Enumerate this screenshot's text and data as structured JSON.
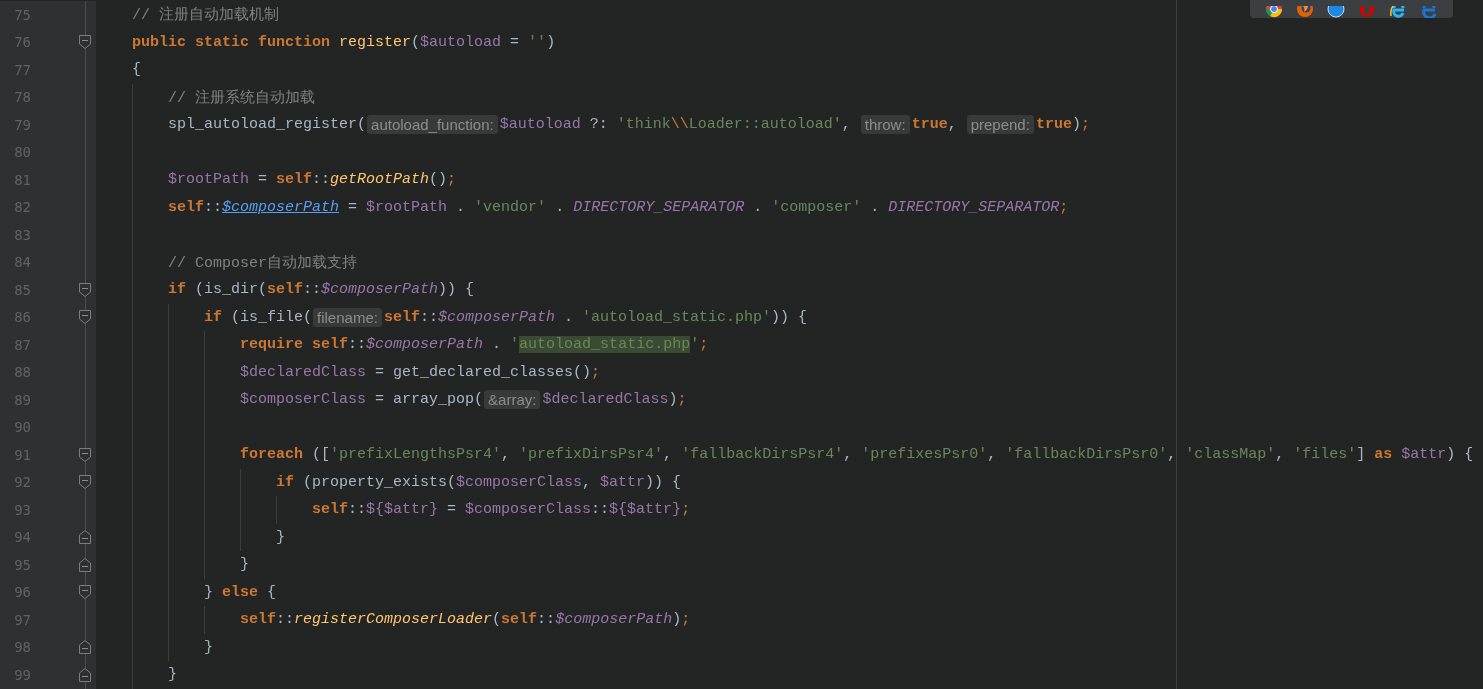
{
  "editor": {
    "lines": [
      {
        "number": "75",
        "tokens": [
          {
            "kind": "comment",
            "text": "    // 注册自动加载机制"
          }
        ]
      },
      {
        "number": "76",
        "fold_start": true,
        "tokens": [
          {
            "kind": "keyword",
            "text": "    public static function "
          },
          {
            "kind": "decl",
            "text": "register"
          },
          {
            "kind": "plain",
            "text": "("
          },
          {
            "kind": "var",
            "text": "$autoload"
          },
          {
            "kind": "plain",
            "text": " = "
          },
          {
            "kind": "string",
            "text": "''"
          },
          {
            "kind": "plain",
            "text": ")"
          }
        ]
      },
      {
        "number": "77",
        "tokens": [
          {
            "kind": "plain",
            "text": "    {"
          }
        ]
      },
      {
        "number": "78",
        "tokens": [
          {
            "kind": "comment",
            "text": "        // 注册系统自动加载"
          }
        ]
      },
      {
        "number": "79",
        "tokens": [
          {
            "kind": "plain",
            "text": "        spl_autoload_register("
          },
          {
            "kind": "hint",
            "text": "autoload_function:"
          },
          {
            "kind": "var",
            "text": "$autoload"
          },
          {
            "kind": "plain",
            "text": " ?: "
          },
          {
            "kind": "string",
            "text": "'think"
          },
          {
            "kind": "escape",
            "text": "\\\\"
          },
          {
            "kind": "string",
            "text": "Loader::autoload'"
          },
          {
            "kind": "plain",
            "text": ", "
          },
          {
            "kind": "hint",
            "text": "throw:"
          },
          {
            "kind": "keyword",
            "text": "true"
          },
          {
            "kind": "plain",
            "text": ", "
          },
          {
            "kind": "hint",
            "text": "prepend:"
          },
          {
            "kind": "keyword",
            "text": "true"
          },
          {
            "kind": "plain",
            "text": ")"
          },
          {
            "kind": "semi",
            "text": ";"
          }
        ]
      },
      {
        "number": "80"
      },
      {
        "number": "81",
        "tokens": [
          {
            "kind": "var",
            "text": "        $rootPath"
          },
          {
            "kind": "plain",
            "text": " = "
          },
          {
            "kind": "keyword",
            "text": "self"
          },
          {
            "kind": "plain",
            "text": "::"
          },
          {
            "kind": "call",
            "text": "getRootPath"
          },
          {
            "kind": "plain",
            "text": "()"
          },
          {
            "kind": "semi",
            "text": ";"
          }
        ]
      },
      {
        "number": "82",
        "tokens": [
          {
            "kind": "keyword",
            "text": "        self"
          },
          {
            "kind": "plain",
            "text": "::"
          },
          {
            "kind": "link",
            "text": "$composerPath"
          },
          {
            "kind": "plain",
            "text": " = "
          },
          {
            "kind": "var",
            "text": "$rootPath"
          },
          {
            "kind": "plain",
            "text": " . "
          },
          {
            "kind": "string",
            "text": "'vendor'"
          },
          {
            "kind": "plain",
            "text": " . "
          },
          {
            "kind": "const",
            "text": "DIRECTORY_SEPARATOR"
          },
          {
            "kind": "plain",
            "text": " . "
          },
          {
            "kind": "string",
            "text": "'composer'"
          },
          {
            "kind": "plain",
            "text": " . "
          },
          {
            "kind": "const",
            "text": "DIRECTORY_SEPARATOR"
          },
          {
            "kind": "semi",
            "text": ";"
          }
        ]
      },
      {
        "number": "83"
      },
      {
        "number": "84",
        "tokens": [
          {
            "kind": "comment",
            "text": "        // Composer自动加载支持"
          }
        ]
      },
      {
        "number": "85",
        "fold_start": true,
        "tokens": [
          {
            "kind": "keyword",
            "text": "        if"
          },
          {
            "kind": "plain",
            "text": " (is_dir("
          },
          {
            "kind": "keyword",
            "text": "self"
          },
          {
            "kind": "plain",
            "text": "::"
          },
          {
            "kind": "svar",
            "text": "$composerPath"
          },
          {
            "kind": "plain",
            "text": ")) {"
          }
        ]
      },
      {
        "number": "86",
        "fold_start": true,
        "tokens": [
          {
            "kind": "keyword",
            "text": "            if"
          },
          {
            "kind": "plain",
            "text": " (is_file("
          },
          {
            "kind": "hint",
            "text": "filename:"
          },
          {
            "kind": "keyword",
            "text": "self"
          },
          {
            "kind": "plain",
            "text": "::"
          },
          {
            "kind": "svar",
            "text": "$composerPath"
          },
          {
            "kind": "plain",
            "text": " . "
          },
          {
            "kind": "string",
            "text": "'autoload_static.php'"
          },
          {
            "kind": "plain",
            "text": ")) {"
          }
        ]
      },
      {
        "number": "87",
        "tokens": [
          {
            "kind": "keyword",
            "text": "                require self"
          },
          {
            "kind": "plain",
            "text": "::"
          },
          {
            "kind": "svar",
            "text": "$composerPath"
          },
          {
            "kind": "plain",
            "text": " . "
          },
          {
            "kind": "string",
            "text": "'"
          },
          {
            "kind": "highlight",
            "text": "autoload_static.php"
          },
          {
            "kind": "string",
            "text": "'"
          },
          {
            "kind": "semi",
            "text": ";"
          }
        ]
      },
      {
        "number": "88",
        "tokens": [
          {
            "kind": "var",
            "text": "                $declaredClass"
          },
          {
            "kind": "plain",
            "text": " = get_declared_classes()"
          },
          {
            "kind": "semi",
            "text": ";"
          }
        ]
      },
      {
        "number": "89",
        "tokens": [
          {
            "kind": "var",
            "text": "                $composerClass"
          },
          {
            "kind": "plain",
            "text": " = array_pop("
          },
          {
            "kind": "hint",
            "text": "&array:"
          },
          {
            "kind": "var",
            "text": "$declaredClass"
          },
          {
            "kind": "plain",
            "text": ")"
          },
          {
            "kind": "semi",
            "text": ";"
          }
        ]
      },
      {
        "number": "90"
      },
      {
        "number": "91",
        "fold_start": true,
        "tokens": [
          {
            "kind": "keyword",
            "text": "                foreach"
          },
          {
            "kind": "plain",
            "text": " (["
          },
          {
            "kind": "string",
            "text": "'prefixLengthsPsr4'"
          },
          {
            "kind": "plain",
            "text": ", "
          },
          {
            "kind": "string",
            "text": "'prefixDirsPsr4'"
          },
          {
            "kind": "plain",
            "text": ", "
          },
          {
            "kind": "string",
            "text": "'fallbackDirsPsr4'"
          },
          {
            "kind": "plain",
            "text": ", "
          },
          {
            "kind": "string",
            "text": "'prefixesPsr0'"
          },
          {
            "kind": "plain",
            "text": ", "
          },
          {
            "kind": "string",
            "text": "'fallbackDirsPsr0'"
          },
          {
            "kind": "plain",
            "text": ", "
          },
          {
            "kind": "string",
            "text": "'classMap'"
          },
          {
            "kind": "plain",
            "text": ", "
          },
          {
            "kind": "string",
            "text": "'files'"
          },
          {
            "kind": "plain",
            "text": "] "
          },
          {
            "kind": "keyword",
            "text": "as "
          },
          {
            "kind": "var",
            "text": "$attr"
          },
          {
            "kind": "plain",
            "text": ") {"
          }
        ]
      },
      {
        "number": "92",
        "fold_start": true,
        "tokens": [
          {
            "kind": "keyword",
            "text": "                    if"
          },
          {
            "kind": "plain",
            "text": " (property_exists("
          },
          {
            "kind": "var",
            "text": "$composerClass"
          },
          {
            "kind": "plain",
            "text": ", "
          },
          {
            "kind": "var",
            "text": "$attr"
          },
          {
            "kind": "plain",
            "text": ")) {"
          }
        ]
      },
      {
        "number": "93",
        "tokens": [
          {
            "kind": "keyword",
            "text": "                        self"
          },
          {
            "kind": "plain",
            "text": "::"
          },
          {
            "kind": "var",
            "text": "${$attr}"
          },
          {
            "kind": "plain",
            "text": " = "
          },
          {
            "kind": "var",
            "text": "$composerClass"
          },
          {
            "kind": "plain",
            "text": "::"
          },
          {
            "kind": "var",
            "text": "${$attr}"
          },
          {
            "kind": "semi",
            "text": ";"
          }
        ]
      },
      {
        "number": "94",
        "fold_end": true,
        "tokens": [
          {
            "kind": "plain",
            "text": "                    }"
          }
        ]
      },
      {
        "number": "95",
        "fold_end": true,
        "tokens": [
          {
            "kind": "plain",
            "text": "                }"
          }
        ]
      },
      {
        "number": "96",
        "fold_start": true,
        "tokens": [
          {
            "kind": "plain",
            "text": "            } "
          },
          {
            "kind": "keyword",
            "text": "else"
          },
          {
            "kind": "plain",
            "text": " {"
          }
        ]
      },
      {
        "number": "97",
        "tokens": [
          {
            "kind": "keyword",
            "text": "                self"
          },
          {
            "kind": "plain",
            "text": "::"
          },
          {
            "kind": "call",
            "text": "registerComposerLoader"
          },
          {
            "kind": "plain",
            "text": "("
          },
          {
            "kind": "keyword",
            "text": "self"
          },
          {
            "kind": "plain",
            "text": "::"
          },
          {
            "kind": "svar",
            "text": "$composerPath"
          },
          {
            "kind": "plain",
            "text": ")"
          },
          {
            "kind": "semi",
            "text": ";"
          }
        ]
      },
      {
        "number": "98",
        "fold_end": true,
        "tokens": [
          {
            "kind": "plain",
            "text": "            }"
          }
        ]
      },
      {
        "number": "99",
        "fold_end": true,
        "tokens": [
          {
            "kind": "plain",
            "text": "        }"
          }
        ]
      }
    ]
  }
}
